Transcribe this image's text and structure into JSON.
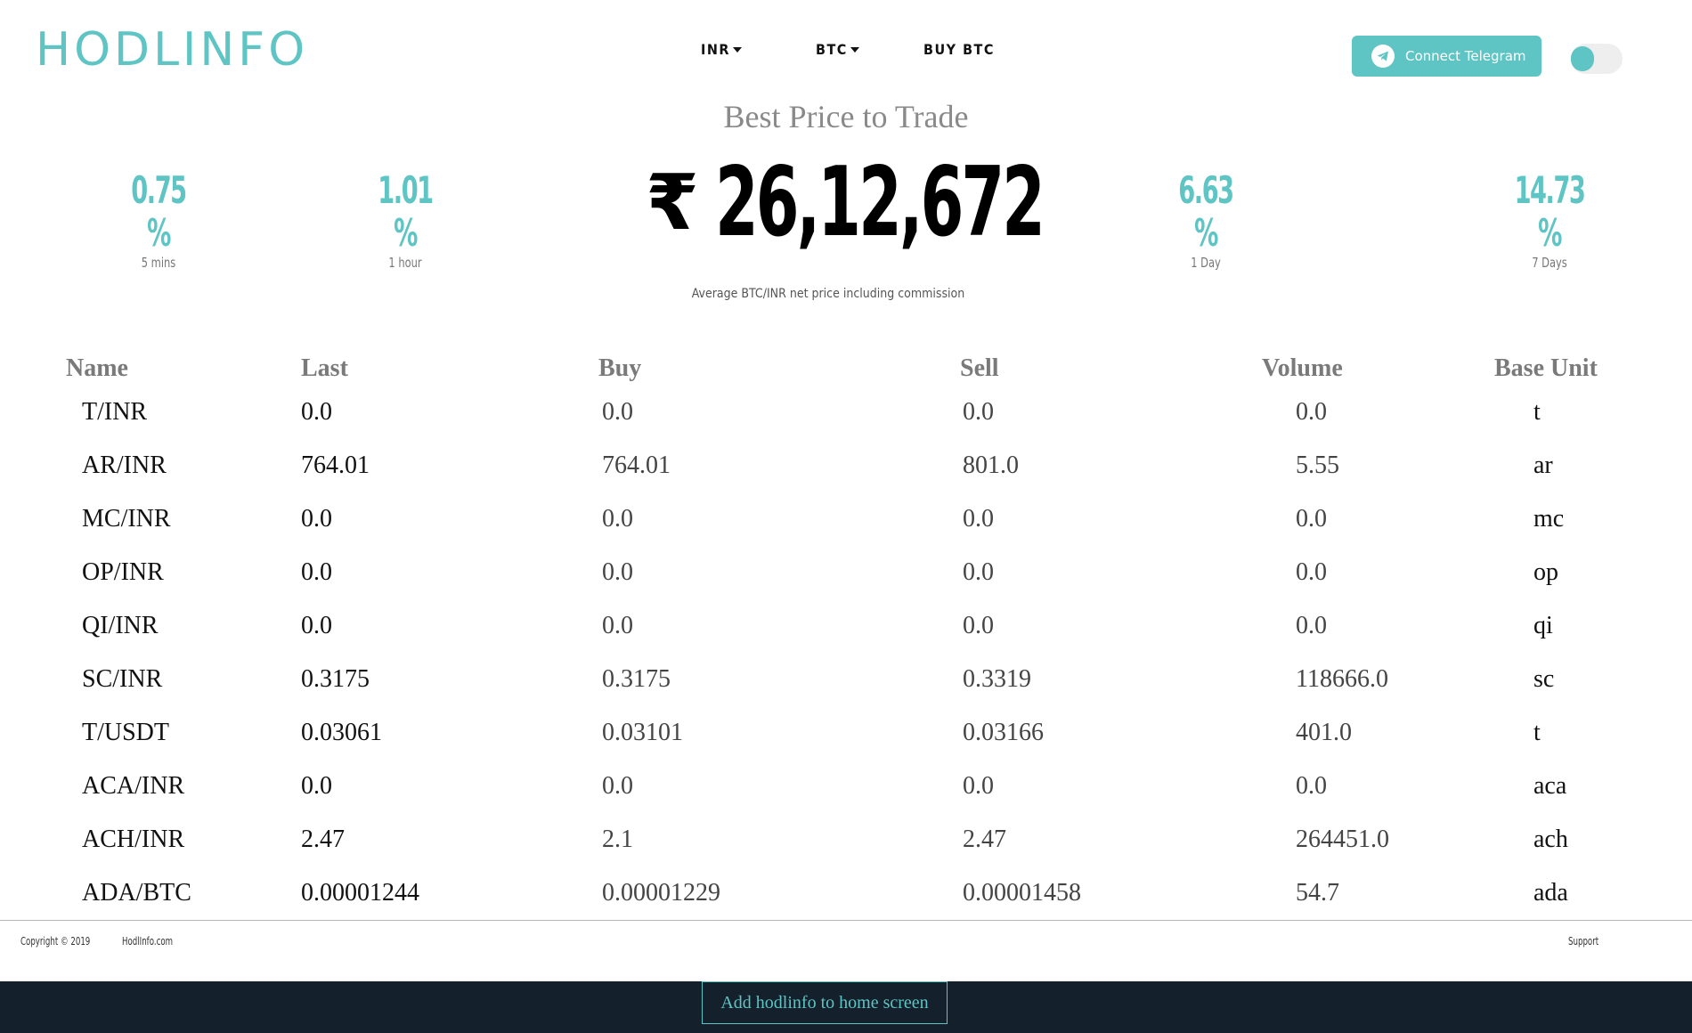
{
  "header": {
    "logo": "HODLINFO",
    "nav": {
      "currency": "INR",
      "coin": "BTC",
      "buy": "BUY BTC"
    },
    "telegram_label": "Connect Telegram"
  },
  "hero": {
    "title": "Best Price to Trade",
    "price_symbol": "₹",
    "price": "26,12,672",
    "note": "Average BTC/INR net price including commission",
    "stats": [
      {
        "value": "0.75 %",
        "label": "5 mins"
      },
      {
        "value": "1.01 %",
        "label": "1 hour"
      },
      {
        "value": "6.63 %",
        "label": "1 Day"
      },
      {
        "value": "14.73 %",
        "label": "7 Days"
      }
    ]
  },
  "table": {
    "headers": [
      "Name",
      "Last",
      "Buy",
      "Sell",
      "Volume",
      "Base Unit"
    ],
    "rows": [
      {
        "name": "T/INR",
        "last": "0.0",
        "buy": "0.0",
        "sell": "0.0",
        "volume": "0.0",
        "unit": "t"
      },
      {
        "name": "AR/INR",
        "last": "764.01",
        "buy": "764.01",
        "sell": "801.0",
        "volume": "5.55",
        "unit": "ar"
      },
      {
        "name": "MC/INR",
        "last": "0.0",
        "buy": "0.0",
        "sell": "0.0",
        "volume": "0.0",
        "unit": "mc"
      },
      {
        "name": "OP/INR",
        "last": "0.0",
        "buy": "0.0",
        "sell": "0.0",
        "volume": "0.0",
        "unit": "op"
      },
      {
        "name": "QI/INR",
        "last": "0.0",
        "buy": "0.0",
        "sell": "0.0",
        "volume": "0.0",
        "unit": "qi"
      },
      {
        "name": "SC/INR",
        "last": "0.3175",
        "buy": "0.3175",
        "sell": "0.3319",
        "volume": "118666.0",
        "unit": "sc"
      },
      {
        "name": "T/USDT",
        "last": "0.03061",
        "buy": "0.03101",
        "sell": "0.03166",
        "volume": "401.0",
        "unit": "t"
      },
      {
        "name": "ACA/INR",
        "last": "0.0",
        "buy": "0.0",
        "sell": "0.0",
        "volume": "0.0",
        "unit": "aca"
      },
      {
        "name": "ACH/INR",
        "last": "2.47",
        "buy": "2.1",
        "sell": "2.47",
        "volume": "264451.0",
        "unit": "ach"
      },
      {
        "name": "ADA/BTC",
        "last": "0.00001244",
        "buy": "0.00001229",
        "sell": "0.00001458",
        "volume": "54.7",
        "unit": "ada"
      }
    ]
  },
  "footer": {
    "copyright": "Copyright © 2019",
    "site": "HodlInfo.com",
    "support": "Support",
    "add_home": "Add hodlinfo to home screen"
  },
  "colors": {
    "accent": "#5ec4c4",
    "bottom_bar": "#14202b"
  }
}
